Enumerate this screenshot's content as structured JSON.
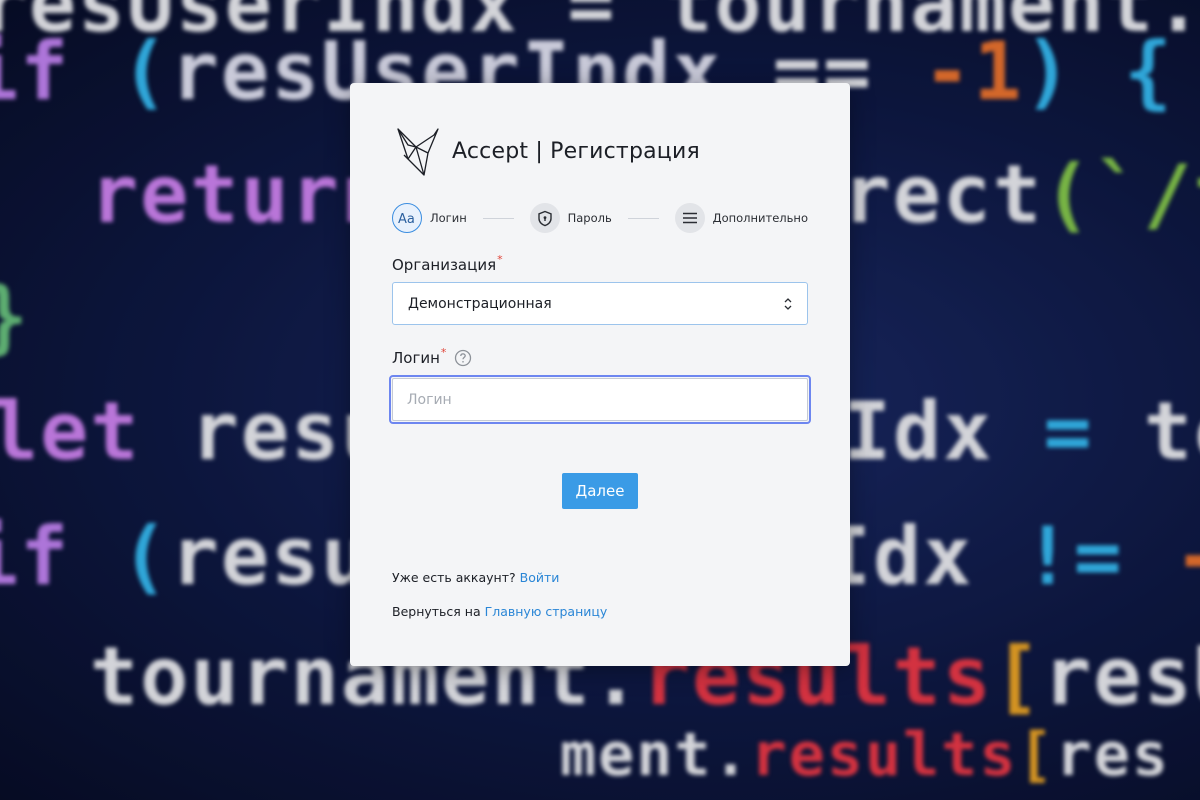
{
  "background": {
    "code_lines": [
      {
        "text": "if (resUserIndx",
        "color": "#ccb8ff"
      },
      {
        "text": "return res.redirect(`/tournament",
        "color": "#d494ff"
      },
      {
        "text": "let resultAttemptIdx = tournament.",
        "color": "#ffffff"
      },
      {
        "text": "if (resultAttemptIdx != -1) {",
        "color": "#b9d4ff"
      },
      {
        "text": "tournament.results[resUserIndx]",
        "color": "#ffffff"
      }
    ]
  },
  "brand": {
    "logo_icon": "origami-bird-icon",
    "title": "Accept | Регистрация"
  },
  "steps": [
    {
      "label": "Логин",
      "icon": "font-icon",
      "active": true
    },
    {
      "label": "Пароль",
      "icon": "shield-lock-icon",
      "active": false
    },
    {
      "label": "Дополнительно",
      "icon": "menu-lines-icon",
      "active": false
    }
  ],
  "form": {
    "organization": {
      "label": "Организация",
      "required_mark": "*",
      "value": "Демонстрационная"
    },
    "login": {
      "label": "Логин",
      "required_mark": "*",
      "value": "",
      "placeholder": "Логин"
    },
    "submit_label": "Далее"
  },
  "footer": {
    "account_text": "Уже есть аккаунт?",
    "login_link": "Войти",
    "return_text": "Вернуться на",
    "home_link": "Главную страницу"
  },
  "colors": {
    "accent": "#3a9be6",
    "link": "#2a86d6",
    "required": "#e0453a",
    "focus_ring": "#6d86f0"
  }
}
